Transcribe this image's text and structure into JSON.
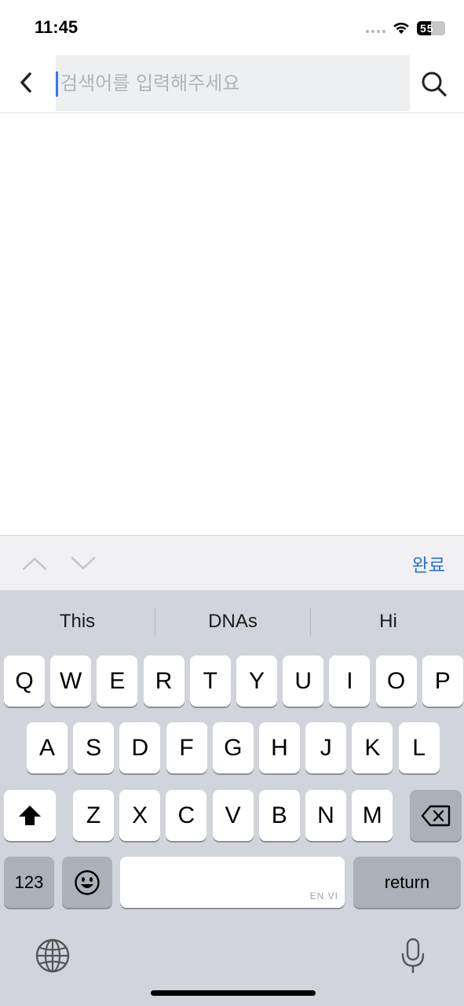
{
  "status_bar": {
    "time": "11:45",
    "battery": "55"
  },
  "search": {
    "placeholder": "검색어를 입력해주세요",
    "value": ""
  },
  "accessory": {
    "done_label": "완료"
  },
  "keyboard": {
    "suggestions": [
      "This",
      "DNAs",
      "Hi"
    ],
    "row1": [
      "Q",
      "W",
      "E",
      "R",
      "T",
      "Y",
      "U",
      "I",
      "O",
      "P"
    ],
    "row2": [
      "A",
      "S",
      "D",
      "F",
      "G",
      "H",
      "J",
      "K",
      "L"
    ],
    "row3": [
      "Z",
      "X",
      "C",
      "V",
      "B",
      "N",
      "M"
    ],
    "num_label": "123",
    "return_label": "return",
    "space_lang": "EN VI"
  },
  "icons": {
    "back": "chevron-left-icon",
    "search": "magnifier-icon",
    "shift": "shift-arrow-icon",
    "delete": "backspace-icon",
    "emoji": "smiley-icon",
    "globe": "globe-icon",
    "mic": "microphone-icon"
  }
}
